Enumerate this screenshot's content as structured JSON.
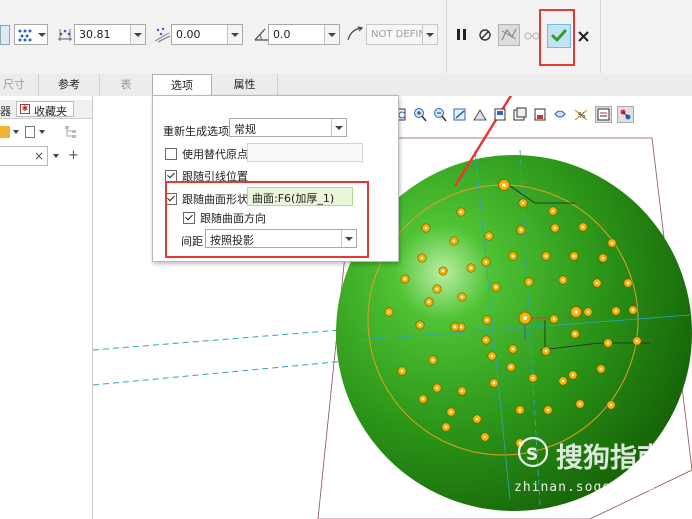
{
  "toolbar": {
    "spacing_value": "30.81",
    "offset_value": "0.00",
    "angle_value": "0.0",
    "reference_placeholder": "NOT DEFIN"
  },
  "tabs": [
    {
      "label": "尺寸",
      "state": "dim"
    },
    {
      "label": "参考",
      "state": "normal"
    },
    {
      "label": "表",
      "state": "dim"
    },
    {
      "label": "选项",
      "state": "active"
    },
    {
      "label": "属性",
      "state": "normal"
    }
  ],
  "left_panel": {
    "tab_partial": "器",
    "favorites_label": "收藏夹"
  },
  "options_panel": {
    "regenerate_label": "重新生成选项",
    "regenerate_value": "常规",
    "use_alt_origin_label": "使用替代原点",
    "use_alt_origin_checked": false,
    "follow_leader_label": "跟随引线位置",
    "follow_leader_checked": true,
    "follow_surface_label": "跟随曲面形状",
    "follow_surface_checked": true,
    "surface_ref_value": "曲面:F6(加厚_1)",
    "follow_surface_dir_label": "跟随曲面方向",
    "follow_surface_dir_checked": true,
    "spacing_label": "间距",
    "spacing_value": "按照投影"
  },
  "watermark": {
    "brand": "搜狗指南",
    "url": "zhinan.sogou.com"
  },
  "colors": {
    "sphere": "#2f9a1a",
    "highlight_box": "#e53935",
    "confirm": "#3a9a2a",
    "pattern": "#f5b300"
  }
}
